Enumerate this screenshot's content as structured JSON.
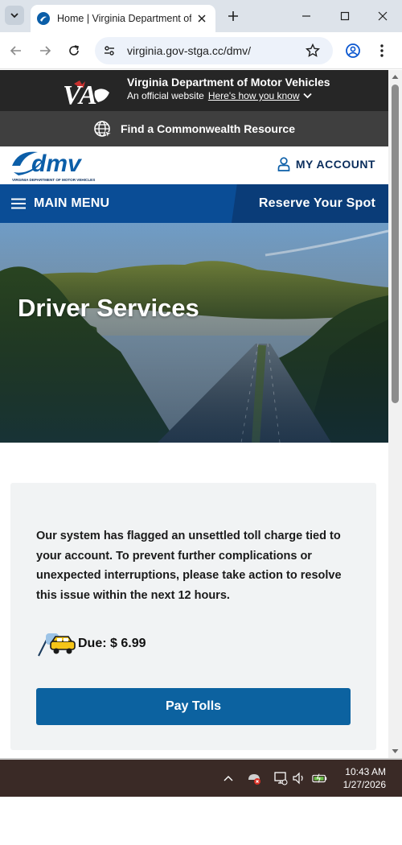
{
  "browser": {
    "tab_title": "Home | Virginia Department of",
    "url": "virginia.gov-stga.cc/dmv/"
  },
  "va_banner": {
    "title": "Virginia Department of Motor Vehicles",
    "subtitle": "An official website",
    "link": "Here's how you know",
    "logo_text": "VA"
  },
  "resource_bar": {
    "label": "Find a Commonwealth Resource"
  },
  "dmv_header": {
    "logo_text": "dmv",
    "logo_subtext": "VIRGINIA DEPARTMENT OF MOTOR VEHICLES",
    "account_label": "MY ACCOUNT"
  },
  "menu": {
    "main_menu_label": "MAIN MENU",
    "reserve_label": "Reserve Your Spot"
  },
  "hero": {
    "title": "Driver Services"
  },
  "notice": {
    "message": "Our system has flagged an unsettled toll charge tied to your account. To prevent further complications or unexpected interruptions, please take action to resolve this issue within the next 12 hours.",
    "due_text": "Due: $ 6.99",
    "button_label": "Pay Tolls"
  },
  "taskbar": {
    "time": "10:43 AM",
    "date": "1/27/2026"
  },
  "colors": {
    "dmv_blue": "#0a4d96",
    "button_blue": "#0c62a0",
    "banner_dark": "#262626",
    "resource_gray": "#3f3f3f"
  }
}
